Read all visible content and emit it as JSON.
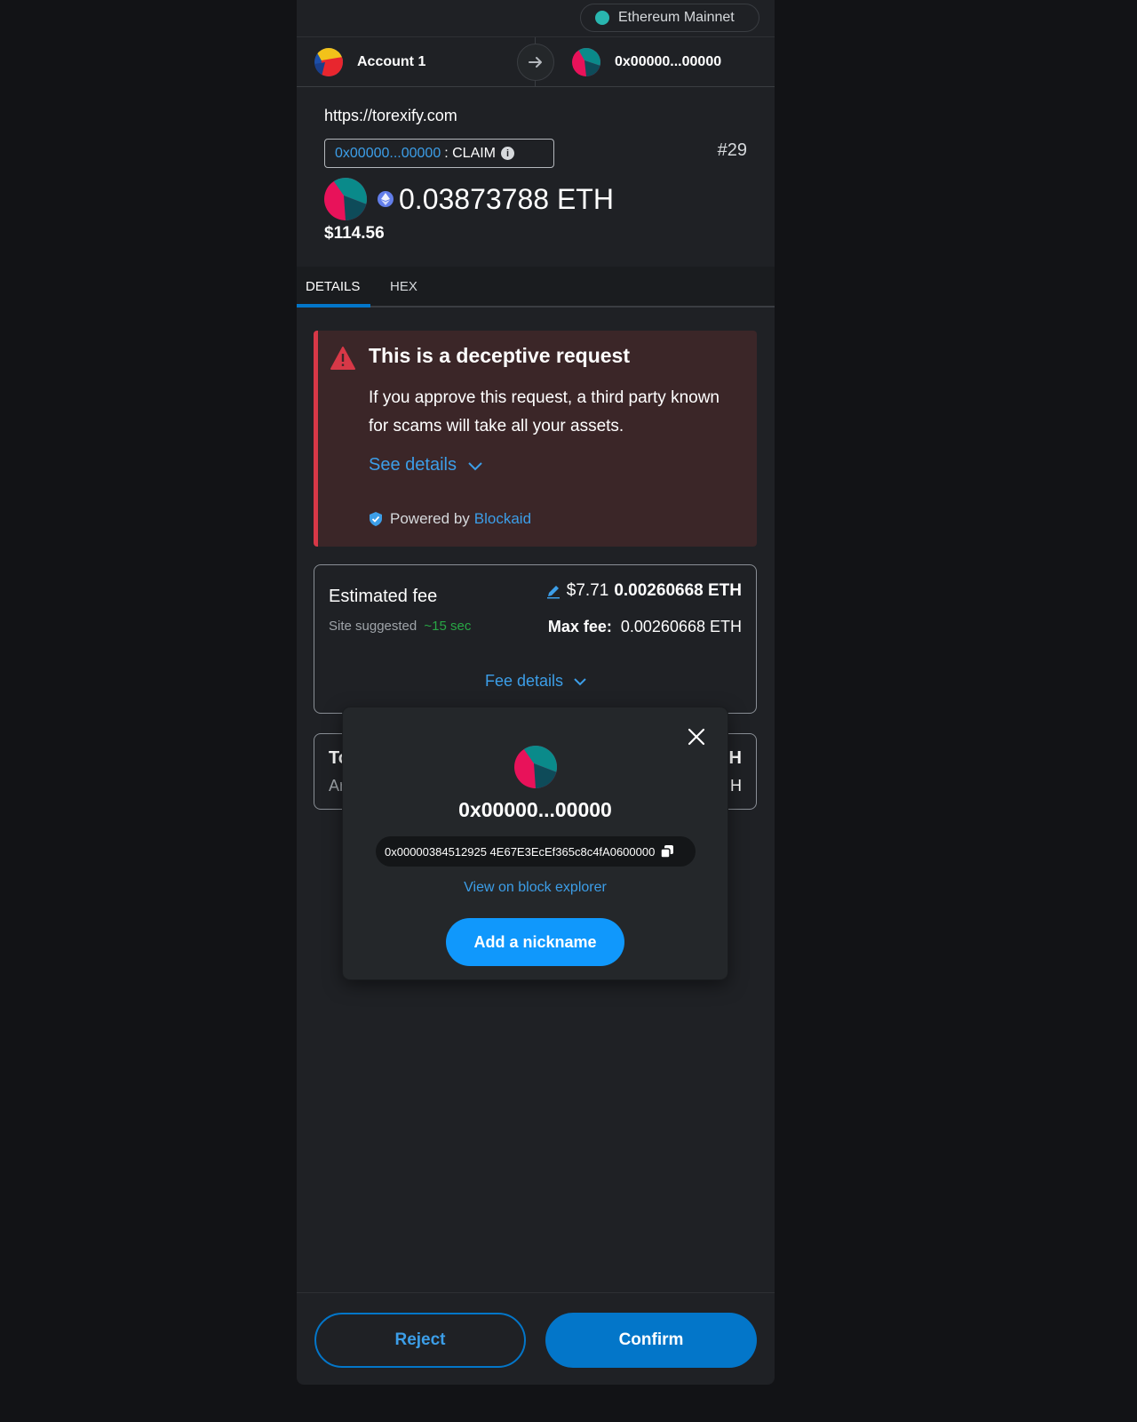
{
  "network": {
    "name": "Ethereum Mainnet",
    "dot_color": "#29b6af"
  },
  "accounts": {
    "from_label": "Account 1",
    "to_label": "0x00000...00000"
  },
  "summary": {
    "origin": "https://torexify.com",
    "method_address": "0x00000...00000",
    "method_name": ": CLAIM",
    "nonce": "#29",
    "amount": "0.03873788 ETH",
    "fiat": "$114.56"
  },
  "tabs": {
    "details": "DETAILS",
    "hex": "HEX",
    "active": "DETAILS"
  },
  "alert": {
    "title": "This is a deceptive request",
    "body": "If you approve this request, a third party known for scams will take all your assets.",
    "see_details": "See details",
    "powered_by": "Powered by",
    "provider": "Blockaid",
    "color": "#d73847"
  },
  "fee": {
    "label": "Estimated fee",
    "site_suggested": "Site suggested",
    "time": "~15 sec",
    "fiat": "$7.71",
    "eth": "0.00260668 ETH",
    "max_fee_label": "Max fee:",
    "max_fee_value": "0.00260668 ETH",
    "details_link": "Fee details"
  },
  "total_partial": {
    "left_line1": "To",
    "left_line2": "Ar",
    "right_line1": "H",
    "right_line2": "H"
  },
  "popover": {
    "name": "0x00000...00000",
    "full_address": "0x00000384512925 4E67E3EcEf365c8c4fA0600000",
    "explorer_link": "View on block explorer",
    "nickname_button": "Add a nickname"
  },
  "footer": {
    "reject": "Reject",
    "confirm": "Confirm",
    "accent": "#0376c9"
  }
}
